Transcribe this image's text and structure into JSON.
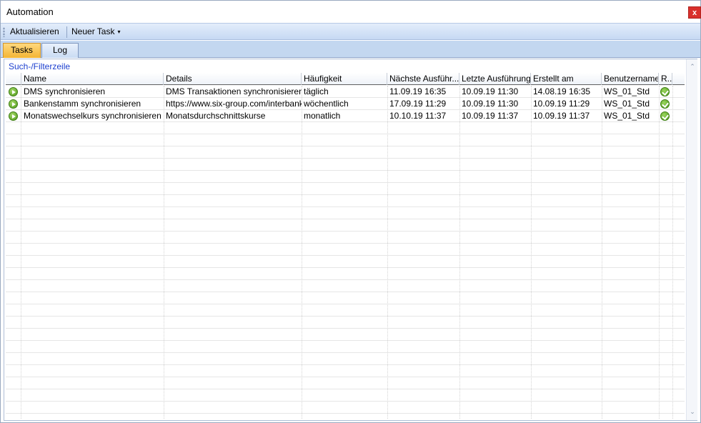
{
  "window": {
    "title": "Automation",
    "close_label": "x"
  },
  "toolbar": {
    "refresh_label": "Aktualisieren",
    "new_task_label": "Neuer Task",
    "new_task_caret": "▾"
  },
  "tabs": [
    {
      "label": "Tasks",
      "active": true
    },
    {
      "label": "Log",
      "active": false
    }
  ],
  "filter_row_label": "Such-/Filterzeile",
  "columns": [
    "Name",
    "Details",
    "Häufigkeit",
    "Nächste Ausführ...",
    "Letzte Ausführung",
    "Erstellt am",
    "Benutzername",
    "R..."
  ],
  "rows": [
    {
      "name": "DMS synchronisieren",
      "details": "DMS Transaktionen synchronisieren",
      "frequency": "täglich",
      "next_run": "11.09.19 16:35",
      "last_run": "10.09.19 11:30",
      "created": "14.08.19 16:35",
      "user": "WS_01_Std",
      "status_icon": "check-icon"
    },
    {
      "name": "Bankenstamm synchronisieren",
      "details": "https://www.six-group.com/interbank...",
      "frequency": "wöchentlich",
      "next_run": "17.09.19 11:29",
      "last_run": "10.09.19 11:30",
      "created": "10.09.19 11:29",
      "user": "WS_01_Std",
      "status_icon": "check-icon"
    },
    {
      "name": "Monatswechselkurs synchronisieren",
      "details": "Monatsdurchschnittskurse",
      "frequency": "monatlich",
      "next_run": "10.10.19 11:37",
      "last_run": "10.09.19 11:37",
      "created": "10.09.19 11:37",
      "user": "WS_01_Std",
      "status_icon": "check-icon"
    }
  ],
  "colors": {
    "toolbar": "#c6d9f3",
    "active_tab": "#f3b534",
    "filter_link": "#1c3fcf",
    "status_ok": "#4c9a17"
  },
  "scroll": {
    "up": "⌃",
    "down": "⌄"
  }
}
